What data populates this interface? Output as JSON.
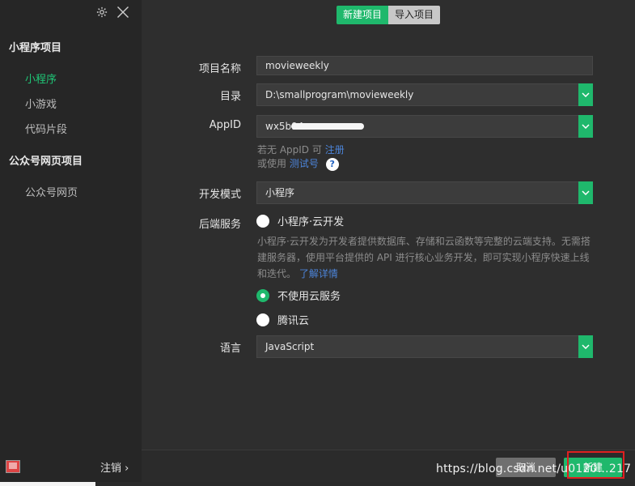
{
  "sidebar": {
    "section_miniprogram": "小程序项目",
    "items_miniprogram": [
      {
        "label": "小程序",
        "active": true
      },
      {
        "label": "小游戏",
        "active": false
      },
      {
        "label": "代码片段",
        "active": false
      }
    ],
    "section_official": "公众号网页项目",
    "items_official": [
      {
        "label": "公众号网页",
        "active": false
      }
    ],
    "logout_label": "注销 ›"
  },
  "tabs": {
    "new_project": "新建项目",
    "import_project": "导入项目"
  },
  "form": {
    "project_name_label": "项目名称",
    "project_name_value": "movieweekly",
    "directory_label": "目录",
    "directory_value": "D:\\smallprogram\\movieweekly",
    "appid_label": "AppID",
    "appid_value": "wx5b94",
    "appid_hint_prefix": "若无 AppID 可",
    "appid_hint_link": "注册",
    "appid_alt_prefix": "或使用",
    "appid_alt_link": "测试号",
    "help_icon_text": "?",
    "dev_mode_label": "开发模式",
    "dev_mode_value": "小程序",
    "backend_label": "后端服务",
    "backend_options": [
      {
        "label": "小程序·云开发",
        "checked": false
      },
      {
        "label": "不使用云服务",
        "checked": true
      },
      {
        "label": "腾讯云",
        "checked": false
      }
    ],
    "cloud_desc": "小程序·云开发为开发者提供数据库、存储和云函数等完整的云端支持。无需搭建服务器，使用平台提供的 API 进行核心业务开发，即可实现小程序快速上线和迭代。",
    "cloud_desc_link": "了解详情",
    "language_label": "语言",
    "language_value": "JavaScript"
  },
  "footer": {
    "cancel_label": "取消",
    "create_label": "新建",
    "watermark": "https://blog.csdn.net/u0120…217"
  },
  "colors": {
    "accent": "#1fb86c",
    "highlight_box": "#e02020",
    "link": "#4c84d9"
  }
}
